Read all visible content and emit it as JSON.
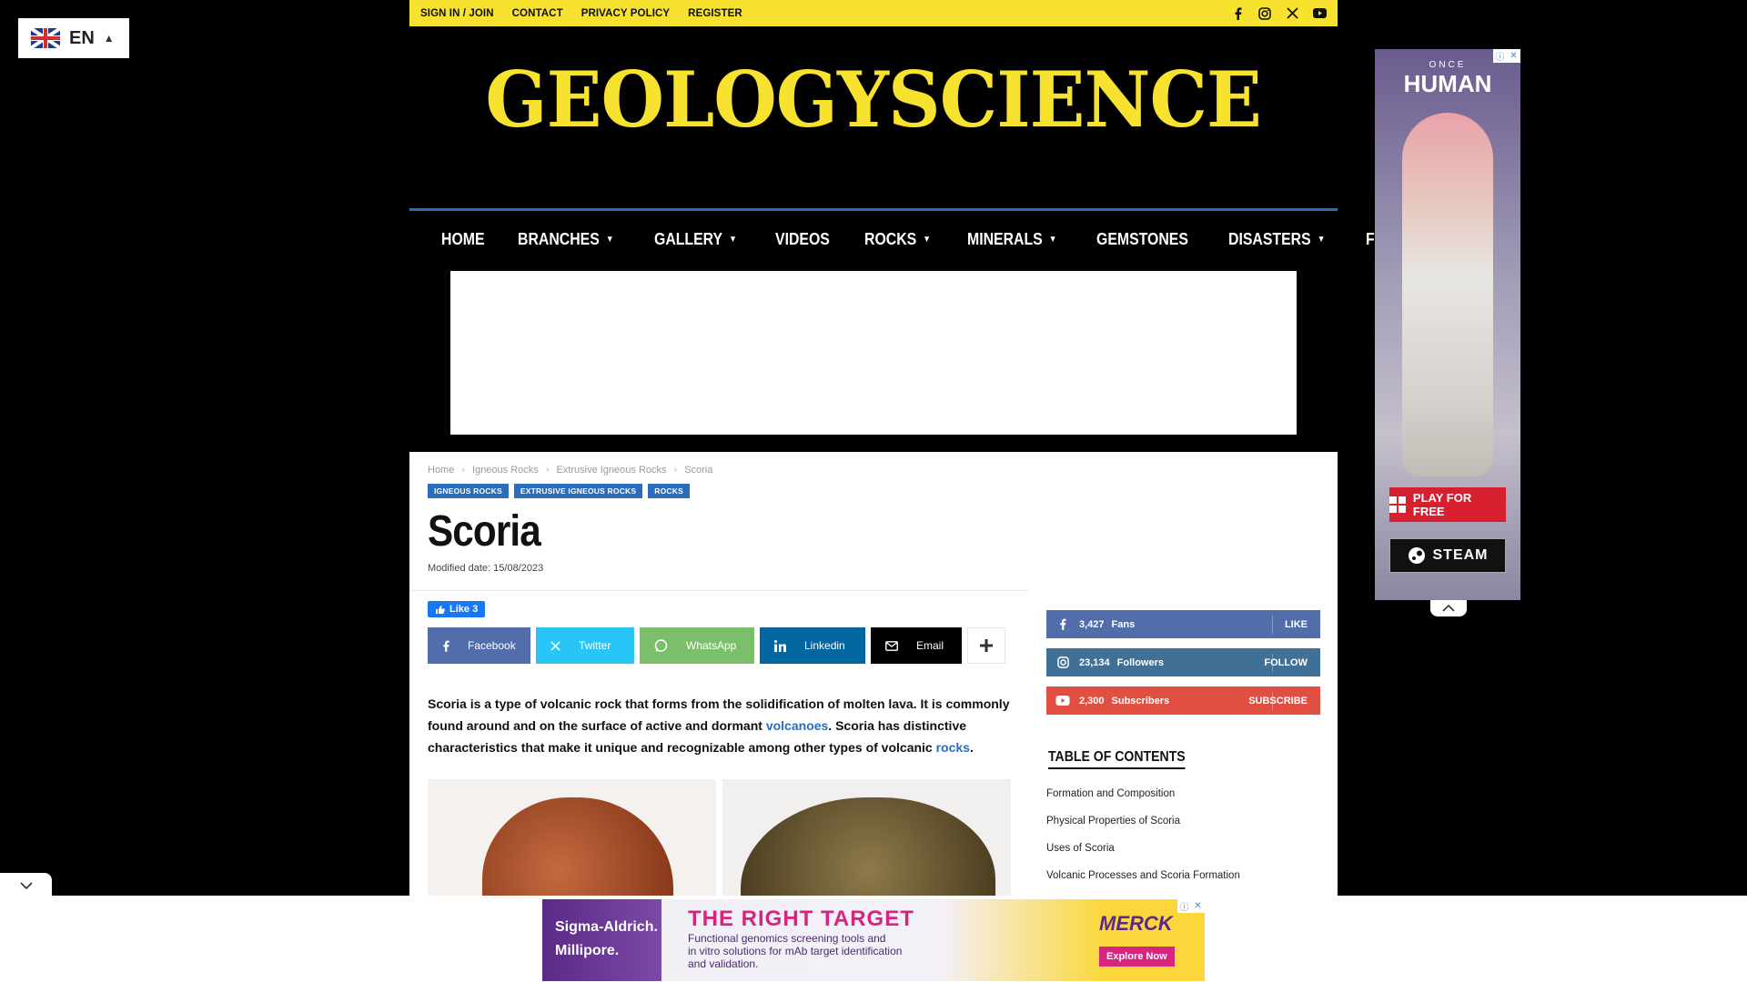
{
  "language": {
    "code": "EN"
  },
  "topbar": {
    "links": [
      "SIGN IN / JOIN",
      "CONTACT",
      "PRIVACY POLICY",
      "REGISTER"
    ],
    "social_icons": [
      "facebook-icon",
      "instagram-icon",
      "x-icon",
      "youtube-icon"
    ]
  },
  "logo": {
    "text": "GEOLOGYSCIENCE",
    "color": "#f7e22f"
  },
  "nav": {
    "items": [
      {
        "label": "HOME",
        "dropdown": false
      },
      {
        "label": "BRANCHES",
        "dropdown": true
      },
      {
        "label": "GALLERY",
        "dropdown": true
      },
      {
        "label": "VIDEOS",
        "dropdown": false
      },
      {
        "label": "ROCKS",
        "dropdown": true
      },
      {
        "label": "MINERALS",
        "dropdown": true
      },
      {
        "label": "GEMSTONES",
        "dropdown": false
      },
      {
        "label": "DISASTERS",
        "dropdown": true
      },
      {
        "label": "FORUM",
        "dropdown": false
      }
    ],
    "accent": "#2a6dbc"
  },
  "article": {
    "breadcrumbs": [
      "Home",
      "Igneous Rocks",
      "Extrusive Igneous Rocks",
      "Scoria"
    ],
    "tags": [
      "IGNEOUS ROCKS",
      "EXTRUSIVE IGNEOUS ROCKS",
      "ROCKS"
    ],
    "title": "Scoria",
    "modified": "Modified date: 15/08/2023",
    "fb_like": "Like 3",
    "share": {
      "facebook": "Facebook",
      "twitter": "Twitter",
      "whatsapp": "WhatsApp",
      "linkedin": "Linkedin",
      "email": "Email"
    },
    "intro": {
      "part1": "Scoria is a type of volcanic rock that forms from the solidification of molten lava. It is commonly found around and on the surface of active and dormant ",
      "link1": "volcanoes",
      "part2": ". Scoria has distinctive characteristics that make it unique and recognizable among other types of volcanic ",
      "link2": "rocks",
      "part3": "."
    }
  },
  "sidebar": {
    "facebook": {
      "count": "3,427",
      "label": "Fans",
      "action": "LIKE"
    },
    "instagram": {
      "count": "23,134",
      "label": "Followers",
      "action": "FOLLOW"
    },
    "youtube": {
      "count": "2,300",
      "label": "Subscribers",
      "action": "SUBSCRIBE"
    },
    "toc_title": "TABLE OF CONTENTS",
    "toc": [
      "Formation and Composition",
      "Physical Properties of Scoria",
      "Uses of Scoria",
      "Volcanic Processes and Scoria Formation"
    ]
  },
  "side_ad": {
    "brand_top": "ONCE",
    "brand_main": "HUMAN",
    "play_button": "PLAY FOR FREE",
    "steam_button": "STEAM"
  },
  "bottom_ad": {
    "company": "Sigma-Aldrich.",
    "company2": "Millipore.",
    "headline": "THE RIGHT TARGET",
    "desc1": "Functional genomics screening tools and",
    "desc2": "in vitro solutions for mAb target identification",
    "desc3": "and validation.",
    "brand": "MERCK",
    "cta": "Explore Now"
  }
}
